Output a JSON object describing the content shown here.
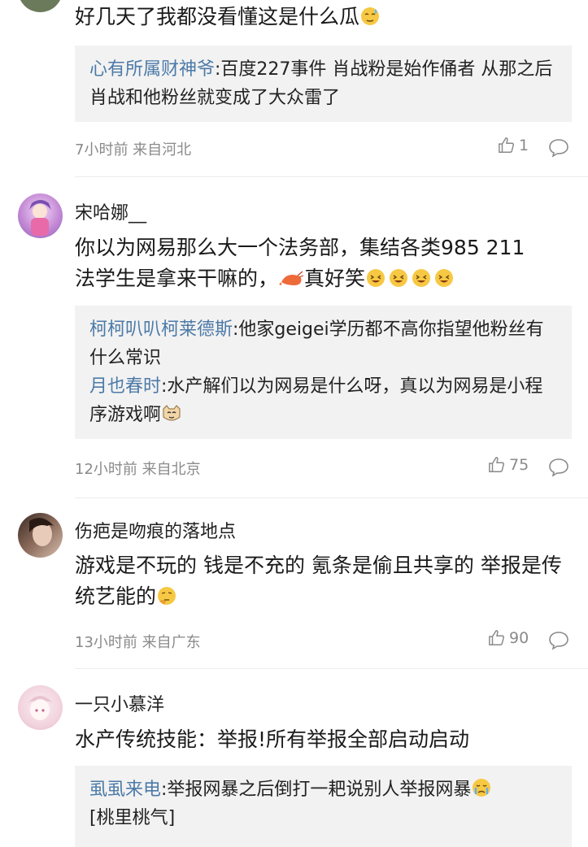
{
  "comments": [
    {
      "text": "好几天了我都没看懂这是什么瓜",
      "replies": [
        {
          "name": "心有所属财神爷",
          "text": ":百度227事件 肖战粉是始作俑者 从那之后肖战和他粉丝就变成了大众雷了"
        }
      ],
      "time": "7小时前 来自河北",
      "likes": "1"
    },
    {
      "username": "宋哈娜__",
      "text_line1": "你以为网易那么大一个法务部，集结各类985 211",
      "text_line2": "法学生是拿来干嘛的，",
      "text_line2_after": "真好笑",
      "replies": [
        {
          "name": "柯柯叭叭柯莱德斯",
          "text": ":他家geigei学历都不高你指望他粉丝有什么常识"
        },
        {
          "name": "月也春时",
          "text": ":水产解们以为网易是什么呀，真以为网易是小程序游戏啊"
        }
      ],
      "time": "12小时前 来自北京",
      "likes": "75"
    },
    {
      "username": "伤疤是吻痕的落地点",
      "text": "游戏是不玩的 钱是不充的 氪条是偷且共享的 举报是传统艺能的",
      "time": "13小时前 来自广东",
      "likes": "90"
    },
    {
      "username": "一只小慕洋",
      "text": "水产传统技能：举报!所有举报全部启动启动",
      "replies": [
        {
          "name": "虱虱来电",
          "text": ":举报网暴之后倒打一耙说别人举报网暴",
          "tail": "[桃里桃气]"
        }
      ]
    }
  ],
  "colors": {
    "link": "#4c7aa8",
    "meta": "#8a8a8a",
    "reply_bg": "#f2f2f2"
  },
  "icons": [
    "thumbs-up-icon",
    "comment-bubble-icon",
    "sweat-emoji",
    "shrimp-emoji",
    "laughing-emoji",
    "cat-emoji",
    "thinking-emoji",
    "crying-emoji"
  ]
}
